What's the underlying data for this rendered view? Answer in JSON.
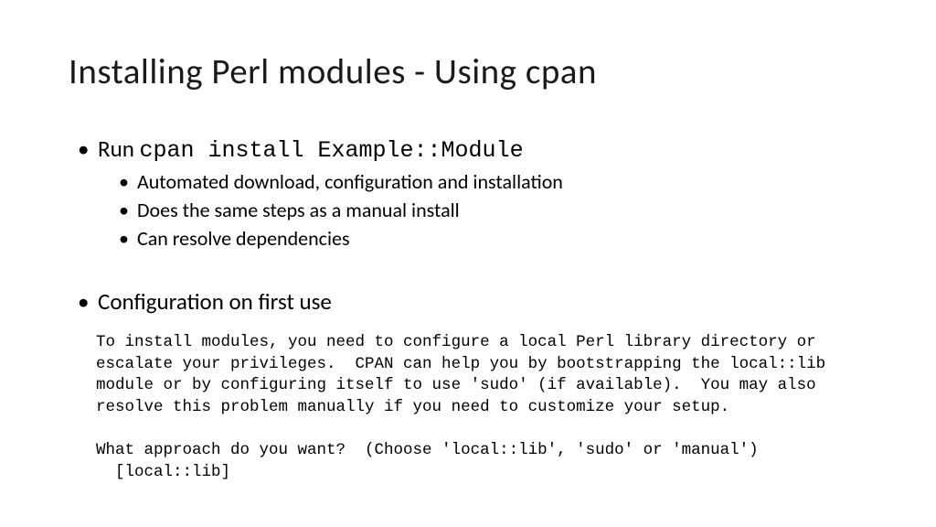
{
  "title": "Installing Perl modules - Using cpan",
  "bullets": {
    "first": {
      "prefix": "Run ",
      "command": "cpan install Example::Module",
      "sub": [
        "Automated download, configuration and installation",
        "Does the same steps as a manual install",
        "Can resolve dependencies"
      ]
    },
    "second": {
      "text": "Configuration on first use"
    }
  },
  "code": "To install modules, you need to configure a local Perl library directory or\nescalate your privileges.  CPAN can help you by bootstrapping the local::lib\nmodule or by configuring itself to use 'sudo' (if available).  You may also\nresolve this problem manually if you need to customize your setup.\n\nWhat approach do you want?  (Choose 'local::lib', 'sudo' or 'manual')\n  [local::lib]"
}
